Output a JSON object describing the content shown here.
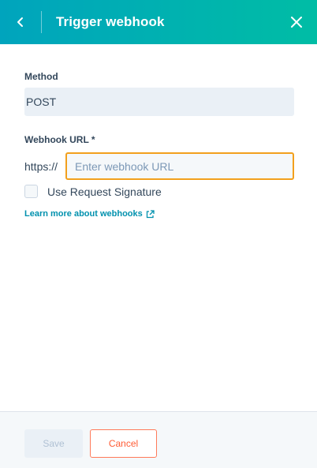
{
  "header": {
    "title": "Trigger webhook",
    "back_icon": "chevron-left-icon",
    "close_icon": "close-icon",
    "gradient_start": "#00a4bd",
    "gradient_end": "#00bda5"
  },
  "method": {
    "label": "Method",
    "value": "POST"
  },
  "webhook_url": {
    "label": "Webhook URL *",
    "prefix": "https://",
    "value": "",
    "placeholder": "Enter webhook URL",
    "focus_color": "#f2a01d"
  },
  "request_signature": {
    "label": "Use Request Signature",
    "checked": false
  },
  "learn_link": {
    "label": "Learn more about webhooks",
    "icon": "external-link-icon",
    "color": "#0091ae"
  },
  "footer": {
    "save_label": "Save",
    "cancel_label": "Cancel",
    "accent": "#ff7a59"
  }
}
